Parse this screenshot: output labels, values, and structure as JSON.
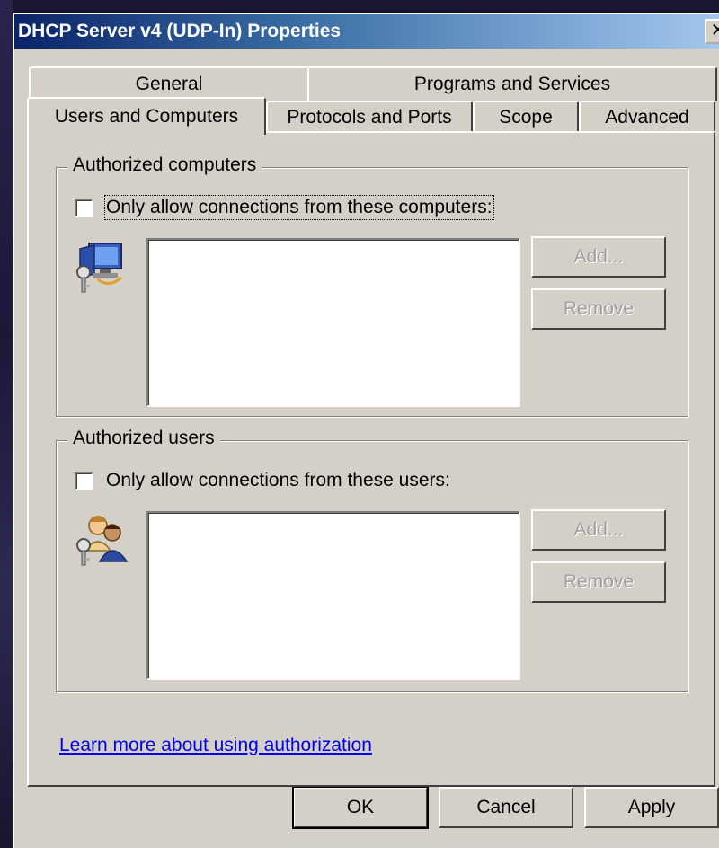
{
  "window": {
    "title": "DHCP Server v4 (UDP-In) Properties",
    "close_glyph": "✕"
  },
  "tabs": {
    "row1": [
      {
        "label": "General"
      },
      {
        "label": "Programs and Services"
      }
    ],
    "row2": [
      {
        "label": "Users and Computers",
        "active": true
      },
      {
        "label": "Protocols and Ports"
      },
      {
        "label": "Scope"
      },
      {
        "label": "Advanced"
      }
    ]
  },
  "computers_group": {
    "legend": "Authorized computers",
    "checkbox_label": "Only allow connections from these computers:",
    "checked": false,
    "icon": "computers-key-icon",
    "add_label": "Add...",
    "remove_label": "Remove",
    "items": []
  },
  "users_group": {
    "legend": "Authorized users",
    "checkbox_label": "Only allow connections from these users:",
    "checked": false,
    "icon": "users-key-icon",
    "add_label": "Add...",
    "remove_label": "Remove",
    "items": []
  },
  "help_link": "Learn more about using authorization",
  "footer": {
    "ok_label": "OK",
    "cancel_label": "Cancel",
    "apply_label": "Apply"
  }
}
